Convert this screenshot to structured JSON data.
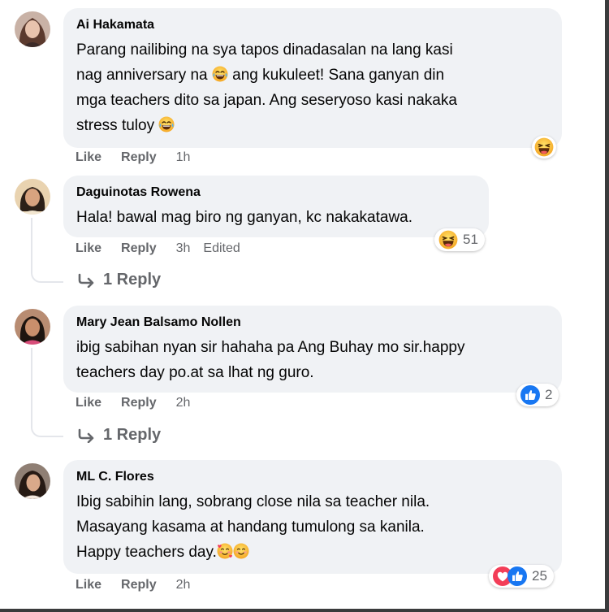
{
  "comments": [
    {
      "author": "Ai Hakamata",
      "lines": [
        "Parang nailibing na sya tapos dinadasalan na lang kasi",
        "nag anniversary na ",
        " ang kukuleet! Sana ganyan din",
        "mga teachers dito sa japan. Ang seseryoso kasi nakaka",
        "stress tuloy "
      ],
      "like": "Like",
      "reply": "Reply",
      "time": "1h",
      "reaction_icon": "laugh-emoji-icon"
    },
    {
      "author": "Daguinotas Rowena",
      "lines": [
        "Hala! bawal mag biro ng ganyan, kc nakakatawa."
      ],
      "like": "Like",
      "reply": "Reply",
      "time": "3h",
      "edited": "Edited",
      "reaction_count": "51",
      "reaction_icon": "laugh-emoji-icon",
      "replies_label": "1 Reply"
    },
    {
      "author": "Mary Jean Balsamo Nollen",
      "lines": [
        "ibig sabihan nyan sir hahaha pa Ang Buhay mo sir.happy",
        "teachers day po.at sa lhat ng guro."
      ],
      "like": "Like",
      "reply": "Reply",
      "time": "2h",
      "reaction_count": "2",
      "reaction_icon": "thumbs-up-icon",
      "replies_label": "1 Reply"
    },
    {
      "author": "ML C. Flores",
      "lines": [
        "Ibig sabihin lang, sobrang close nila sa teacher nila.",
        "Masayang kasama at handang tumulong sa kanila.",
        "Happy teachers day."
      ],
      "like": "Like",
      "reply": "Reply",
      "time": "2h",
      "reaction_count": "25",
      "reaction_icons": [
        "heart-icon",
        "thumbs-up-icon"
      ]
    }
  ],
  "colors": {
    "bubble": "#f0f2f5",
    "secondary_text": "#65676b",
    "like_blue": "#1877f2",
    "love_red": "#f33e58",
    "haha_yellow": "#f7b125"
  }
}
